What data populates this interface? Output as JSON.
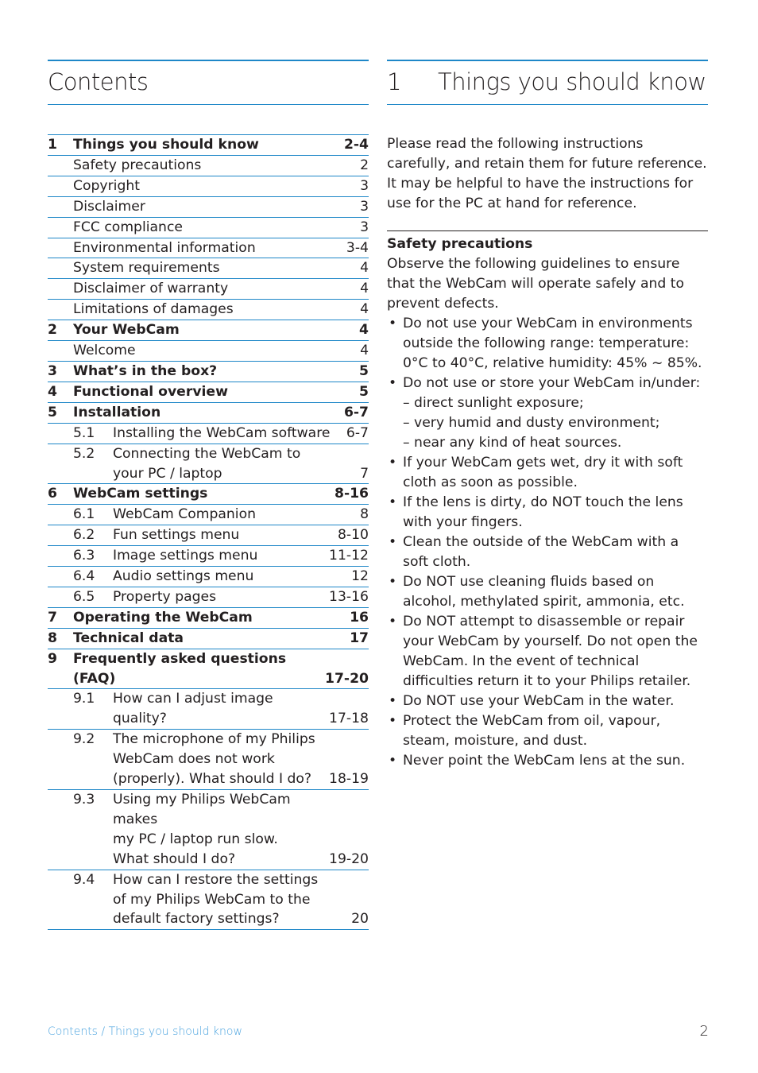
{
  "left": {
    "title": "Contents",
    "toc": [
      {
        "num": "1",
        "title": "Things you should know",
        "page": "2-4",
        "level": "main"
      },
      {
        "num": "",
        "title": "Safety precautions",
        "page": "2",
        "level": "sub"
      },
      {
        "num": "",
        "title": "Copyright",
        "page": "3",
        "level": "sub"
      },
      {
        "num": "",
        "title": "Disclaimer",
        "page": "3",
        "level": "sub"
      },
      {
        "num": "",
        "title": "FCC compliance",
        "page": "3",
        "level": "sub"
      },
      {
        "num": "",
        "title": "Environmental information",
        "page": "3-4",
        "level": "sub"
      },
      {
        "num": "",
        "title": "System requirements",
        "page": "4",
        "level": "sub"
      },
      {
        "num": "",
        "title": "Disclaimer of warranty",
        "page": "4",
        "level": "sub"
      },
      {
        "num": "",
        "title": "Limitations of damages",
        "page": "4",
        "level": "sub"
      },
      {
        "num": "2",
        "title": "Your WebCam",
        "page": "4",
        "level": "main"
      },
      {
        "num": "",
        "title": "Welcome",
        "page": "4",
        "level": "sub"
      },
      {
        "num": "3",
        "title": "What’s in the box?",
        "page": "5",
        "level": "main"
      },
      {
        "num": "4",
        "title": "Functional overview",
        "page": "5",
        "level": "main"
      },
      {
        "num": "5",
        "title": "Installation",
        "page": "6-7",
        "level": "main"
      },
      {
        "num": "5.1",
        "title": "Installing the WebCam software",
        "page": "6-7",
        "level": "subnum"
      },
      {
        "num": "5.2",
        "title": "Connecting the WebCam to\nyour PC / laptop",
        "page": "7",
        "level": "subnum"
      },
      {
        "num": "6",
        "title": "WebCam settings",
        "page": "8-16",
        "level": "main"
      },
      {
        "num": "6.1",
        "title": "WebCam Companion",
        "page": "8",
        "level": "subnum"
      },
      {
        "num": "6.2",
        "title": "Fun settings menu",
        "page": "8-10",
        "level": "subnum"
      },
      {
        "num": "6.3",
        "title": "Image settings menu",
        "page": "11-12",
        "level": "subnum"
      },
      {
        "num": "6.4",
        "title": "Audio settings menu",
        "page": "12",
        "level": "subnum"
      },
      {
        "num": "6.5",
        "title": "Property pages",
        "page": "13-16",
        "level": "subnum"
      },
      {
        "num": "7",
        "title": "Operating the WebCam",
        "page": "16",
        "level": "main"
      },
      {
        "num": "8",
        "title": "Technical data",
        "page": "17",
        "level": "main"
      },
      {
        "num": "9",
        "title": "Frequently asked questions\n(FAQ)",
        "page": "17-20",
        "level": "main"
      },
      {
        "num": "9.1",
        "title": "How can I adjust image quality?",
        "page": "17-18",
        "level": "subnum"
      },
      {
        "num": "9.2",
        "title": "The microphone of my Philips\nWebCam does not work\n(properly). What should I do?",
        "page": "18-19",
        "level": "subnum"
      },
      {
        "num": "9.3",
        "title": "Using my Philips WebCam makes\nmy PC / laptop run slow.\nWhat should I do?",
        "page": "19-20",
        "level": "subnum"
      },
      {
        "num": "9.4",
        "title": "How can I restore the settings\nof my  Philips WebCam to the\ndefault factory settings?",
        "page": "20",
        "level": "subnum"
      }
    ]
  },
  "right": {
    "chapter_num": "1",
    "title": "Things you should know",
    "intro": "Please read the following instructions carefully, and retain them for future reference. It may be helpful to have the instructions for use for the PC at hand for reference.",
    "section_title": "Safety precautions",
    "section_intro": "Observe the following guidelines to ensure that the WebCam will operate safely and to prevent defects.",
    "bullet_glyph": "•",
    "bullets": [
      {
        "text": "Do not use your WebCam in environments outside the following range: temperature: 0°C to 40°C, relative humidity: 45% ~ 85%.",
        "subs": []
      },
      {
        "text": "Do not use or store your WebCam in/under:",
        "subs": [
          "– direct sunlight exposure;",
          "– very humid and dusty environment;",
          "– near any kind of heat sources."
        ]
      },
      {
        "text": "If your WebCam gets wet, dry it with soft cloth as soon as possible.",
        "subs": []
      },
      {
        "text": "If the lens is dirty, do NOT touch the lens with your fingers.",
        "subs": []
      },
      {
        "text": "Clean the outside of the WebCam with a soft cloth.",
        "subs": []
      },
      {
        "text": "Do NOT use cleaning fluids based on alcohol, methylated spirit, ammonia, etc.",
        "subs": []
      },
      {
        "text": "Do NOT attempt to disassemble or repair your WebCam by yourself. Do not open the WebCam. In the event of technical difficulties return it to your Philips retailer.",
        "subs": []
      },
      {
        "text": "Do NOT use your WebCam in the water.",
        "subs": []
      },
      {
        "text": "Protect the WebCam from oil, vapour, steam, moisture, and dust.",
        "subs": []
      },
      {
        "text": "Never point the WebCam lens at the sun.",
        "subs": []
      }
    ]
  },
  "footer": {
    "breadcrumb": "Contents / Things you should know",
    "page_number": "2"
  }
}
